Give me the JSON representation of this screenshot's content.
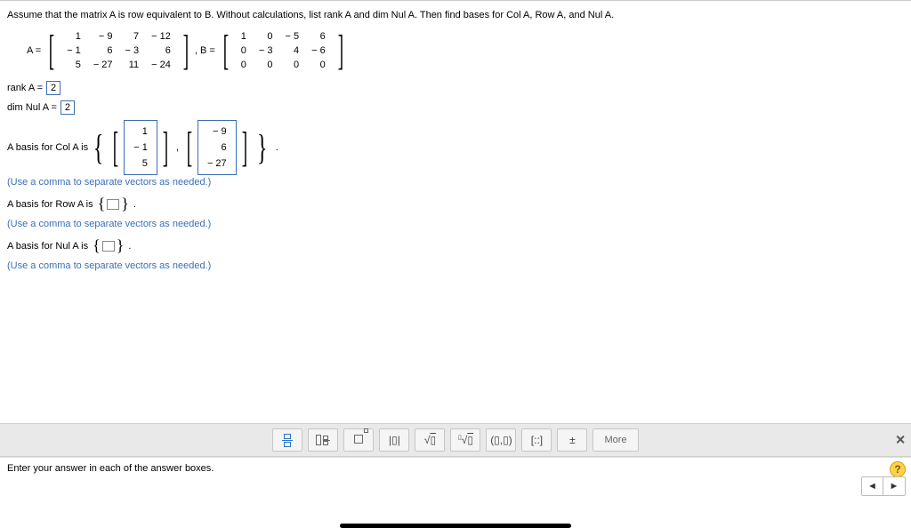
{
  "question": "Assume that the matrix A is row equivalent to B. Without calculations, list rank A and dim Nul A. Then find bases for Col A, Row A, and Nul A.",
  "labels": {
    "A_eq": "A =",
    "B_eq": ", B =",
    "rank": "rank A =",
    "dimnul": "dim Nul A =",
    "basis_col": "A basis for Col A is",
    "basis_row": "A basis for Row A is",
    "basis_nul": "A basis for Nul A is",
    "period": "."
  },
  "hints": {
    "sep": "(Use a comma to separate vectors as needed.)"
  },
  "matrixA": [
    [
      "1",
      "− 9",
      "7",
      "− 12"
    ],
    [
      "− 1",
      "6",
      "− 3",
      "6"
    ],
    [
      "5",
      "− 27",
      "11",
      "− 24"
    ]
  ],
  "matrixB": [
    [
      "1",
      "0",
      "− 5",
      "6"
    ],
    [
      "0",
      "− 3",
      "4",
      "− 6"
    ],
    [
      "0",
      "0",
      "0",
      "0"
    ]
  ],
  "answers": {
    "rank": "2",
    "dimnul": "2",
    "col_vec1": [
      "1",
      "− 1",
      "5"
    ],
    "col_vec2": [
      "− 9",
      "6",
      "− 27"
    ]
  },
  "toolbar": {
    "frac": "▯⁄▯",
    "mixed": "▯½",
    "exp": "▯ⁿ",
    "abs": "|▯|",
    "sqrt": "√▯",
    "nroot": "ⁿ√▯",
    "tuple": "(▯,▯)",
    "matrix": "[::]",
    "pm": "±",
    "more": "More"
  },
  "bottom": {
    "enter": "Enter your answer in each of the answer boxes.",
    "help": "?",
    "prev": "◄",
    "next": "►",
    "close": "✕"
  }
}
